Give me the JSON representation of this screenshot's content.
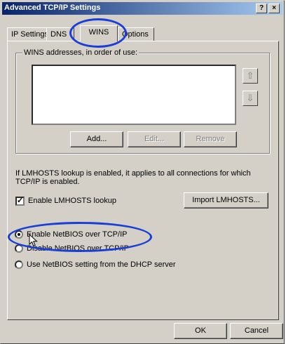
{
  "window": {
    "title": "Advanced TCP/IP Settings",
    "help_label": "?",
    "close_label": "×"
  },
  "tabs": [
    {
      "label": "IP Settings"
    },
    {
      "label": "DNS"
    },
    {
      "label": "WINS"
    },
    {
      "label": "Options"
    }
  ],
  "wins": {
    "group_label": "WINS addresses, in order of use:",
    "up_icon": "⇧",
    "down_icon": "⇩",
    "add_label": "Add...",
    "edit_label": "Edit...",
    "remove_label": "Remove"
  },
  "lmhosts": {
    "info_text": "If LMHOSTS lookup is enabled, it applies to all connections for which TCP/IP is enabled.",
    "enable_label": "Enable LMHOSTS lookup",
    "enable_checked": true,
    "checkmark": "✓",
    "import_label": "Import LMHOSTS..."
  },
  "netbios": {
    "selected": "enable",
    "options": [
      {
        "label": "Enable NetBIOS over TCP/IP"
      },
      {
        "label": "Disable NetBIOS over TCP/IP"
      },
      {
        "label": "Use NetBIOS setting from the DHCP server"
      }
    ]
  },
  "footer": {
    "ok_label": "OK",
    "cancel_label": "Cancel"
  },
  "annotation_color": "#1a3fd6"
}
